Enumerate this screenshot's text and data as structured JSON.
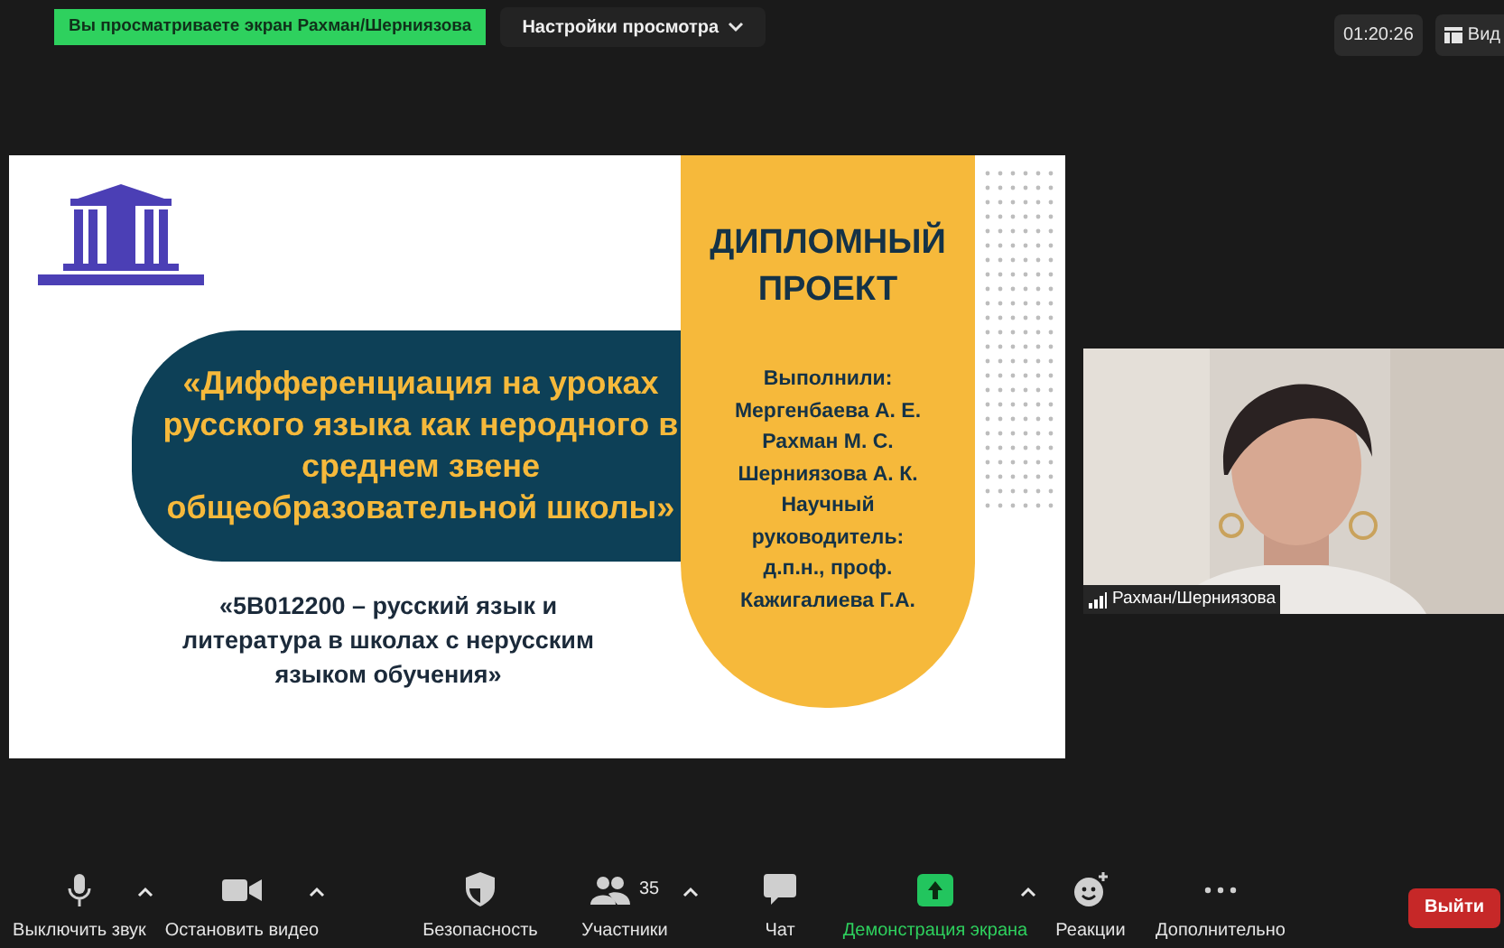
{
  "top_bar": {
    "sharing_banner": "Вы просматриваете экран Рахман/Шерниязова",
    "view_options": "Настройки просмотра",
    "timer": "01:20:26",
    "view_button": "Вид"
  },
  "slide": {
    "title_lines": [
      "ДИПЛОМНЫЙ",
      "ПРОЕКТ"
    ],
    "topic_lines": [
      "«Дифференциация на уроках",
      "русского языка как неродного в",
      "среднем звене",
      "общеобразовательной школы»"
    ],
    "specialty_lines": [
      "«5В012200 – русский язык и",
      "литература в школах с нерусским",
      "языком обучения»"
    ],
    "credits_lines": [
      "Выполнили:",
      "Мергенбаева А. Е.",
      "Рахман М. С.",
      "Шерниязова А. К.",
      "Научный",
      "руководитель:",
      "д.п.н., проф.",
      "Кажигалиева Г.А."
    ]
  },
  "video_tile": {
    "name": "Рахман/Шерниязова"
  },
  "toolbar": [
    {
      "kind": "mic",
      "label": "Выключить звук",
      "caret": true,
      "selected": false
    },
    {
      "kind": "video",
      "label": "Остановить видео",
      "caret": true,
      "selected": false
    },
    {
      "kind": "security",
      "label": "Безопасность",
      "caret": false,
      "selected": false
    },
    {
      "kind": "participants",
      "label": "Участники",
      "count": "35",
      "caret": true,
      "selected": false
    },
    {
      "kind": "chat",
      "label": "Чат",
      "caret": false,
      "selected": false
    },
    {
      "kind": "share",
      "label": "Демонстрация экрана",
      "caret": true,
      "selected": true
    },
    {
      "kind": "reactions",
      "label": "Реакции",
      "caret": false,
      "selected": false
    },
    {
      "kind": "more",
      "label": "Дополнительно",
      "caret": false,
      "selected": false
    }
  ],
  "exit_button": "Выйти"
}
